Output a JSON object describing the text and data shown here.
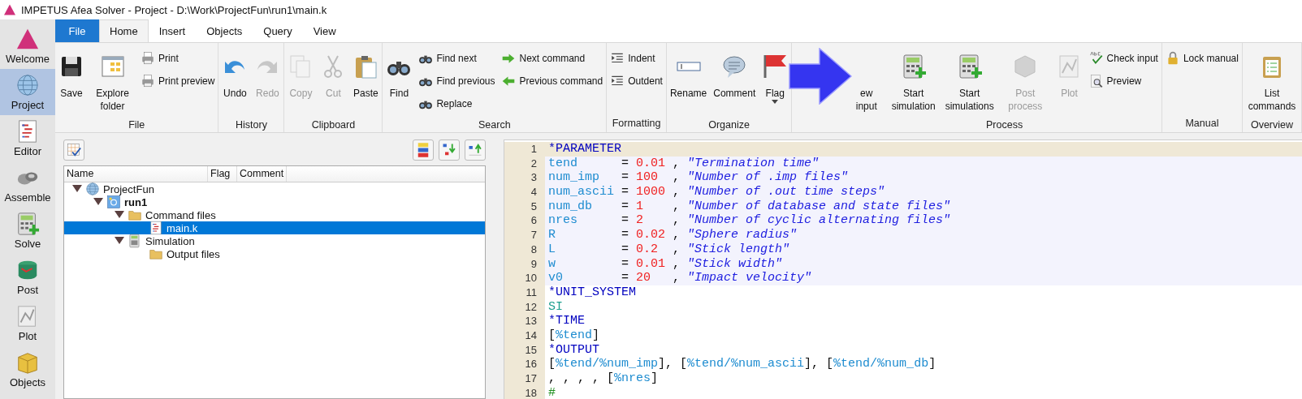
{
  "window": {
    "title": "IMPETUS Afea Solver - Project - D:\\Work\\ProjectFun\\run1\\main.k"
  },
  "sidebar": {
    "items": [
      {
        "label": "Welcome",
        "selected": false
      },
      {
        "label": "Project",
        "selected": true
      },
      {
        "label": "Editor",
        "selected": false
      },
      {
        "label": "Assemble",
        "selected": false
      },
      {
        "label": "Solve",
        "selected": false
      },
      {
        "label": "Post",
        "selected": false
      },
      {
        "label": "Plot",
        "selected": false
      },
      {
        "label": "Objects",
        "selected": false
      }
    ]
  },
  "menu_tab": {
    "label": "File"
  },
  "tabs": [
    {
      "label": "Home",
      "selected": true
    },
    {
      "label": "Insert",
      "selected": false
    },
    {
      "label": "Objects",
      "selected": false
    },
    {
      "label": "Query",
      "selected": false
    },
    {
      "label": "View",
      "selected": false
    }
  ],
  "ribbon": {
    "groups": [
      {
        "label": "File",
        "buttons": [
          {
            "kind": "large",
            "label": "Save",
            "disabled": false
          },
          {
            "kind": "large",
            "label": "Explore folder",
            "disabled": false
          },
          {
            "kind": "small",
            "label": "Print",
            "disabled": false
          },
          {
            "kind": "small",
            "label": "Print preview",
            "disabled": false
          }
        ]
      },
      {
        "label": "History",
        "buttons": [
          {
            "kind": "large",
            "label": "Undo",
            "disabled": false
          },
          {
            "kind": "large",
            "label": "Redo",
            "disabled": true
          }
        ]
      },
      {
        "label": "Clipboard",
        "buttons": [
          {
            "kind": "large",
            "label": "Copy",
            "disabled": true
          },
          {
            "kind": "large",
            "label": "Cut",
            "disabled": true
          },
          {
            "kind": "large",
            "label": "Paste",
            "disabled": false
          }
        ]
      },
      {
        "label": "Search",
        "buttons": [
          {
            "kind": "large",
            "label": "Find",
            "disabled": false
          },
          {
            "kind": "small",
            "label": "Find next",
            "disabled": false
          },
          {
            "kind": "small",
            "label": "Find previous",
            "disabled": false
          },
          {
            "kind": "small",
            "label": "Replace",
            "disabled": false
          },
          {
            "kind": "small",
            "label": "Next command",
            "disabled": false
          },
          {
            "kind": "small",
            "label": "Previous command",
            "disabled": false
          }
        ]
      },
      {
        "label": "Formatting",
        "buttons": [
          {
            "kind": "small",
            "label": "Indent",
            "disabled": false
          },
          {
            "kind": "small",
            "label": "Outdent",
            "disabled": false
          }
        ]
      },
      {
        "label": "Organize",
        "buttons": [
          {
            "kind": "large",
            "label": "Rename",
            "disabled": false
          },
          {
            "kind": "large",
            "label": "Comment",
            "disabled": false
          },
          {
            "kind": "dropdown",
            "label": "Flag",
            "disabled": false
          }
        ]
      },
      {
        "label": "Process",
        "buttons": [
          {
            "kind": "large",
            "label": "ew input",
            "disabled": false
          },
          {
            "kind": "large",
            "label": "Start simulation",
            "disabled": false
          },
          {
            "kind": "large",
            "label": "Start simulations",
            "disabled": false
          },
          {
            "kind": "large",
            "label": "Post process",
            "disabled": true
          },
          {
            "kind": "large",
            "label": "Plot",
            "disabled": true
          },
          {
            "kind": "small",
            "label": "Check input",
            "disabled": false
          },
          {
            "kind": "small",
            "label": "Preview",
            "disabled": false
          }
        ]
      },
      {
        "label": "Manual",
        "buttons": [
          {
            "kind": "small",
            "label": "Lock manual",
            "disabled": false
          }
        ]
      },
      {
        "label": "Overview",
        "buttons": [
          {
            "kind": "large",
            "label": "List commands",
            "disabled": false
          }
        ]
      }
    ]
  },
  "tree": {
    "columns": [
      "Name",
      "Flag",
      "Comment"
    ],
    "nodes": [
      {
        "label": "ProjectFun",
        "expanded": true,
        "current": false,
        "selected": false,
        "children": [
          {
            "label": "run1",
            "expanded": true,
            "current": true,
            "selected": false,
            "children": [
              {
                "label": "Command files",
                "expanded": true,
                "current": false,
                "selected": false,
                "children": [
                  {
                    "label": "main.k",
                    "current": false,
                    "selected": true
                  }
                ]
              },
              {
                "label": "Simulation",
                "expanded": true,
                "current": false,
                "selected": false,
                "children": [
                  {
                    "label": "Output files",
                    "current": false,
                    "selected": false
                  }
                ]
              }
            ]
          }
        ]
      }
    ]
  },
  "editor": {
    "lines": [
      {
        "number": "1",
        "kind": "current",
        "tokens": [
          {
            "kind": "keyword",
            "text": "*PARAMETER"
          }
        ]
      },
      {
        "number": "2",
        "kind": "block",
        "tokens": [
          {
            "kind": "name",
            "text": "tend"
          },
          {
            "kind": "plain",
            "text": "      = "
          },
          {
            "kind": "number",
            "text": "0.01"
          },
          {
            "kind": "plain",
            "text": " , "
          },
          {
            "kind": "string",
            "text": "\"Termination time\""
          }
        ]
      },
      {
        "number": "3",
        "kind": "block",
        "tokens": [
          {
            "kind": "name",
            "text": "num_imp"
          },
          {
            "kind": "plain",
            "text": "   = "
          },
          {
            "kind": "number",
            "text": "100"
          },
          {
            "kind": "plain",
            "text": "  , "
          },
          {
            "kind": "string",
            "text": "\"Number of .imp files\""
          }
        ]
      },
      {
        "number": "4",
        "kind": "block",
        "tokens": [
          {
            "kind": "name",
            "text": "num_ascii"
          },
          {
            "kind": "plain",
            "text": " = "
          },
          {
            "kind": "number",
            "text": "1000"
          },
          {
            "kind": "plain",
            "text": " , "
          },
          {
            "kind": "string",
            "text": "\"Number of .out time steps\""
          }
        ]
      },
      {
        "number": "5",
        "kind": "block",
        "tokens": [
          {
            "kind": "name",
            "text": "num_db"
          },
          {
            "kind": "plain",
            "text": "    = "
          },
          {
            "kind": "number",
            "text": "1"
          },
          {
            "kind": "plain",
            "text": "    , "
          },
          {
            "kind": "string",
            "text": "\"Number of database and state files\""
          }
        ]
      },
      {
        "number": "6",
        "kind": "block",
        "tokens": [
          {
            "kind": "name",
            "text": "nres"
          },
          {
            "kind": "plain",
            "text": "      = "
          },
          {
            "kind": "number",
            "text": "2"
          },
          {
            "kind": "plain",
            "text": "    , "
          },
          {
            "kind": "string",
            "text": "\"Number of cyclic alternating files\""
          }
        ]
      },
      {
        "number": "7",
        "kind": "block",
        "tokens": [
          {
            "kind": "name",
            "text": "R"
          },
          {
            "kind": "plain",
            "text": "         = "
          },
          {
            "kind": "number",
            "text": "0.02"
          },
          {
            "kind": "plain",
            "text": " , "
          },
          {
            "kind": "string",
            "text": "\"Sphere radius\""
          }
        ]
      },
      {
        "number": "8",
        "kind": "block",
        "tokens": [
          {
            "kind": "name",
            "text": "L"
          },
          {
            "kind": "plain",
            "text": "         = "
          },
          {
            "kind": "number",
            "text": "0.2"
          },
          {
            "kind": "plain",
            "text": "  , "
          },
          {
            "kind": "string",
            "text": "\"Stick length\""
          }
        ]
      },
      {
        "number": "9",
        "kind": "block",
        "tokens": [
          {
            "kind": "name",
            "text": "w"
          },
          {
            "kind": "plain",
            "text": "         = "
          },
          {
            "kind": "number",
            "text": "0.01"
          },
          {
            "kind": "plain",
            "text": " , "
          },
          {
            "kind": "string",
            "text": "\"Stick width\""
          }
        ]
      },
      {
        "number": "10",
        "kind": "block",
        "tokens": [
          {
            "kind": "name",
            "text": "v0"
          },
          {
            "kind": "plain",
            "text": "        = "
          },
          {
            "kind": "number",
            "text": "20"
          },
          {
            "kind": "plain",
            "text": "   , "
          },
          {
            "kind": "string",
            "text": "\"Impact velocity\""
          }
        ]
      },
      {
        "number": "11",
        "kind": "plain",
        "tokens": [
          {
            "kind": "keyword",
            "text": "*UNIT_SYSTEM"
          }
        ]
      },
      {
        "number": "12",
        "kind": "plain",
        "tokens": [
          {
            "kind": "value",
            "text": "SI"
          }
        ]
      },
      {
        "number": "13",
        "kind": "plain",
        "tokens": [
          {
            "kind": "keyword",
            "text": "*TIME"
          }
        ]
      },
      {
        "number": "14",
        "kind": "plain",
        "tokens": [
          {
            "kind": "plain",
            "text": "["
          },
          {
            "kind": "name",
            "text": "%tend"
          },
          {
            "kind": "plain",
            "text": "]"
          }
        ]
      },
      {
        "number": "15",
        "kind": "plain",
        "tokens": [
          {
            "kind": "keyword",
            "text": "*OUTPUT"
          }
        ]
      },
      {
        "number": "16",
        "kind": "plain",
        "tokens": [
          {
            "kind": "plain",
            "text": "["
          },
          {
            "kind": "name",
            "text": "%tend/%num_imp"
          },
          {
            "kind": "plain",
            "text": "], ["
          },
          {
            "kind": "name",
            "text": "%tend/%num_ascii"
          },
          {
            "kind": "plain",
            "text": "], ["
          },
          {
            "kind": "name",
            "text": "%tend/%num_db"
          },
          {
            "kind": "plain",
            "text": "]"
          }
        ]
      },
      {
        "number": "17",
        "kind": "plain",
        "tokens": [
          {
            "kind": "plain",
            "text": ", , , , ["
          },
          {
            "kind": "name",
            "text": "%nres"
          },
          {
            "kind": "plain",
            "text": "]"
          }
        ]
      },
      {
        "number": "18",
        "kind": "plain",
        "tokens": [
          {
            "kind": "comment",
            "text": "#"
          }
        ]
      }
    ]
  }
}
